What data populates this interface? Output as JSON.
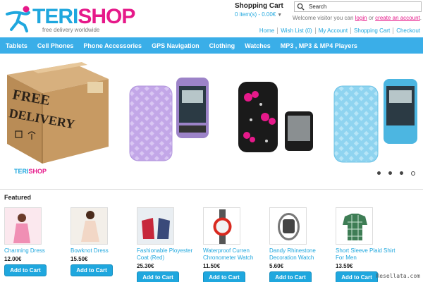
{
  "header": {
    "logo_teri": "TERI",
    "logo_shop": "SHOP",
    "tagline": "free delivery worldwide",
    "cart_title": "Shopping Cart",
    "cart_items": "0 item(s) - 0.00€",
    "search_placeholder": "Search",
    "welcome_prefix": "Welcome visitor you can",
    "login": "login",
    "or": "or",
    "create_account": "create an account",
    "welcome_suffix": ".",
    "links": [
      "Home",
      "Wish List (0)",
      "My Account",
      "Shopping Cart",
      "Checkout"
    ]
  },
  "nav": [
    "Tablets",
    "Cell Phones",
    "Phone Accessories",
    "GPS Navigation",
    "Clothing",
    "Watches",
    "MP3 , MP3 & MP4 Players"
  ],
  "banner": {
    "box_line1": "FREE",
    "box_line2": "DELIVERY",
    "box_logo_teri": "TERI",
    "box_logo_shop": "SHOP",
    "slides": 4,
    "active_slide": 4
  },
  "featured": {
    "title": "Featured",
    "products": [
      {
        "name": "Charming Dress",
        "price": "12.00€",
        "button": "Add to Cart"
      },
      {
        "name": "Bowknot Dress",
        "price": "15.50€",
        "button": "Add to Cart"
      },
      {
        "name": "Fashionable Ployester Coat (Red)",
        "price": "25.30€",
        "button": "Add to Cart"
      },
      {
        "name": "Waterproof Curren Chronometer Watch",
        "price": "11.50€",
        "button": "Add to Cart"
      },
      {
        "name": "Dandy Rhinestone Decoration Watch",
        "price": "5.60€",
        "button": "Add to Cart"
      },
      {
        "name": "Short Sleeve Plaid Shirt For Men",
        "price": "13.59€",
        "button": "Add to Cart"
      }
    ]
  },
  "watermark": "Resellata.com",
  "colors": {
    "brand_blue": "#1fa7de",
    "brand_pink": "#e6198a",
    "nav_bg": "#3aaee8"
  }
}
